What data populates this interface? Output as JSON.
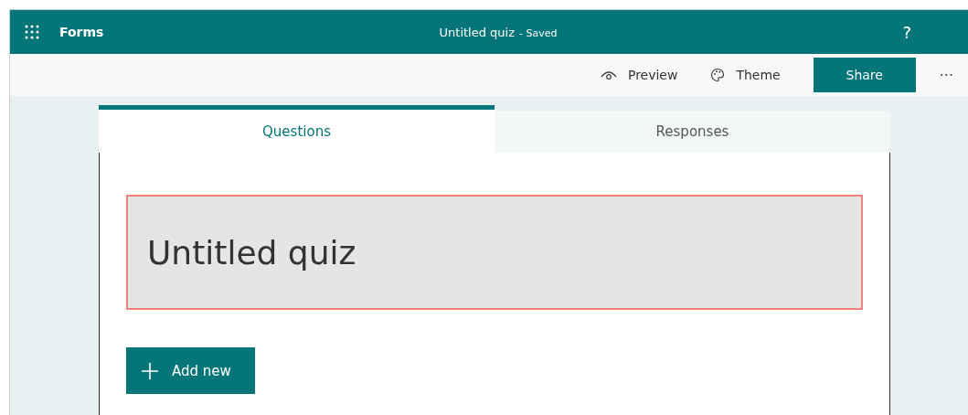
{
  "header": {
    "app_name": "Forms",
    "title": "Untitled quiz",
    "status": "- Saved",
    "help": "?"
  },
  "toolbar": {
    "items": [
      {
        "kind": "preview",
        "label": "Preview"
      },
      {
        "kind": "theme",
        "label": "Theme"
      }
    ],
    "share": "Share",
    "more": "···"
  },
  "tabs": [
    {
      "label": "Questions",
      "selected": true
    },
    {
      "label": "Responses",
      "selected": false
    }
  ],
  "quiz_title": {
    "text": "Untitled quiz",
    "highlighted": true
  },
  "add_button": {
    "label": "Add new"
  }
}
